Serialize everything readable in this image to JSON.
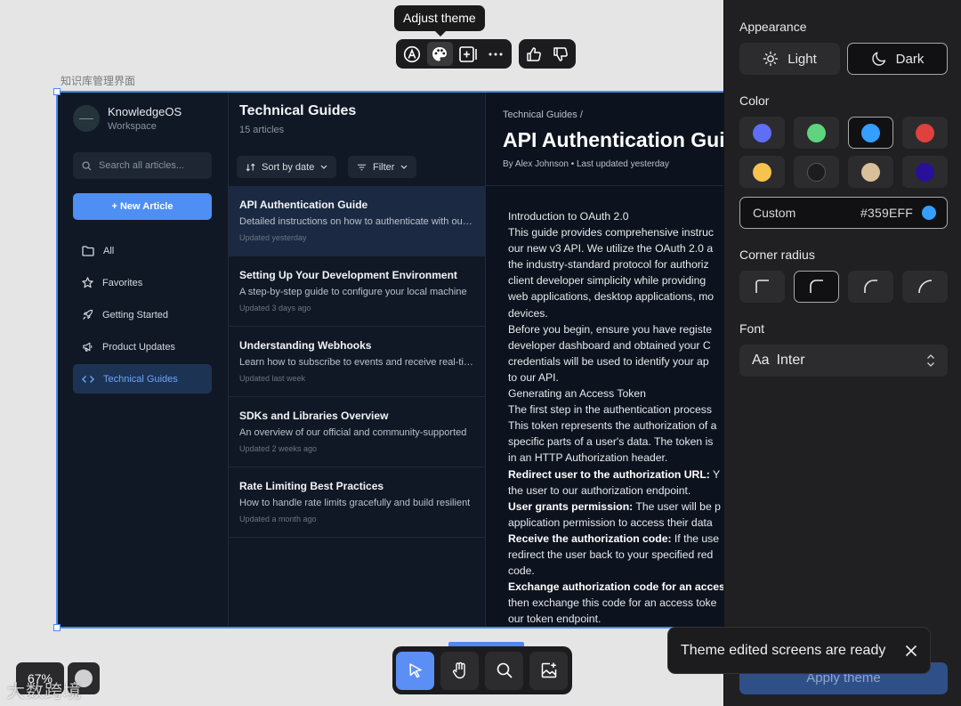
{
  "canvas": {
    "frame_label": "知识库管理界面",
    "zoom": "67%",
    "watermark": "大数跨境"
  },
  "tooltip": "Adjust theme",
  "app": {
    "brand": {
      "name": "KnowledgeOS",
      "sub": "Workspace"
    },
    "search_placeholder": "Search all articles...",
    "new_article": "+ New Article",
    "nav": [
      {
        "label": "All",
        "icon": "folder-icon"
      },
      {
        "label": "Favorites",
        "icon": "star-icon"
      },
      {
        "label": "Getting Started",
        "icon": "rocket-icon"
      },
      {
        "label": "Product Updates",
        "icon": "megaphone-icon"
      },
      {
        "label": "Technical Guides",
        "icon": "code-icon",
        "active": true
      }
    ],
    "list": {
      "title": "Technical Guides",
      "count": "15 articles",
      "sort": "Sort by date",
      "filter": "Filter",
      "articles": [
        {
          "title": "API Authentication Guide",
          "desc": "Detailed instructions on how to authenticate with our API",
          "date": "Updated yesterday",
          "active": true
        },
        {
          "title": "Setting Up Your Development Environment",
          "desc": "A step-by-step guide to configure your local machine",
          "date": "Updated 3 days ago"
        },
        {
          "title": "Understanding Webhooks",
          "desc": "Learn how to subscribe to events and receive real-time",
          "date": "Updated last week"
        },
        {
          "title": "SDKs and Libraries Overview",
          "desc": "An overview of our official and community-supported",
          "date": "Updated 2 weeks ago"
        },
        {
          "title": "Rate Limiting Best Practices",
          "desc": "How to handle rate limits gracefully and build resilient",
          "date": "Updated a month ago"
        }
      ]
    },
    "doc": {
      "breadcrumb": "Technical Guides  /",
      "title": "API Authentication Gui",
      "byline": "By Alex Johnson • Last updated yesterday",
      "lines": [
        {
          "text": "Introduction to OAuth 2.0"
        },
        {
          "text": "This guide provides comprehensive instruc"
        },
        {
          "text": "our new v3 API. We utilize the OAuth 2.0 a"
        },
        {
          "text": "the industry-standard protocol for authoriz"
        },
        {
          "text": "client developer simplicity while providing"
        },
        {
          "text": "web applications, desktop applications, mo"
        },
        {
          "text": "devices."
        },
        {
          "text": "Before you begin, ensure you have registe"
        },
        {
          "text": "developer dashboard and obtained your C"
        },
        {
          "text": "credentials will be used to identify your ap"
        },
        {
          "text": "to our API."
        },
        {
          "text": "Generating an Access Token"
        },
        {
          "text": "The first step in the authentication process"
        },
        {
          "text": "This token represents the authorization of a"
        },
        {
          "text": "specific parts of a user's data. The token is"
        },
        {
          "text": "in an HTTP Authorization header."
        },
        {
          "bold": "Redirect user to the authorization URL:",
          "text": " Y"
        },
        {
          "text": "the user to our authorization endpoint."
        },
        {
          "bold": "User grants permission:",
          "text": " The user will be p"
        },
        {
          "text": "application permission to access their data"
        },
        {
          "bold": "Receive the authorization code:",
          "text": " If the use"
        },
        {
          "text": "redirect the user back to your specified red"
        },
        {
          "text": "code."
        },
        {
          "bold": "Exchange authorization code for an acces",
          "text": ""
        },
        {
          "text": "then exchange this code for an access toke"
        },
        {
          "text": "our token endpoint."
        }
      ]
    }
  },
  "panel": {
    "appearance_label": "Appearance",
    "light": "Light",
    "dark": "Dark",
    "color_label": "Color",
    "swatches": [
      "#5e6ef5",
      "#5fd47e",
      "#359EFF",
      "#e0403e",
      "#f5c34e",
      "#1c1c1e",
      "#d9c09a",
      "#2a0f99"
    ],
    "selected_swatch": 2,
    "custom_label": "Custom",
    "custom_hex": "#359EFF",
    "radius_label": "Corner radius",
    "font_label": "Font",
    "font_value": "Inter",
    "font_prefix": "Aa",
    "apply": "Apply theme"
  },
  "toast": "Theme edited screens are ready",
  "colors": {
    "accent": "#4e88f0",
    "button": "#4e8ff4"
  }
}
